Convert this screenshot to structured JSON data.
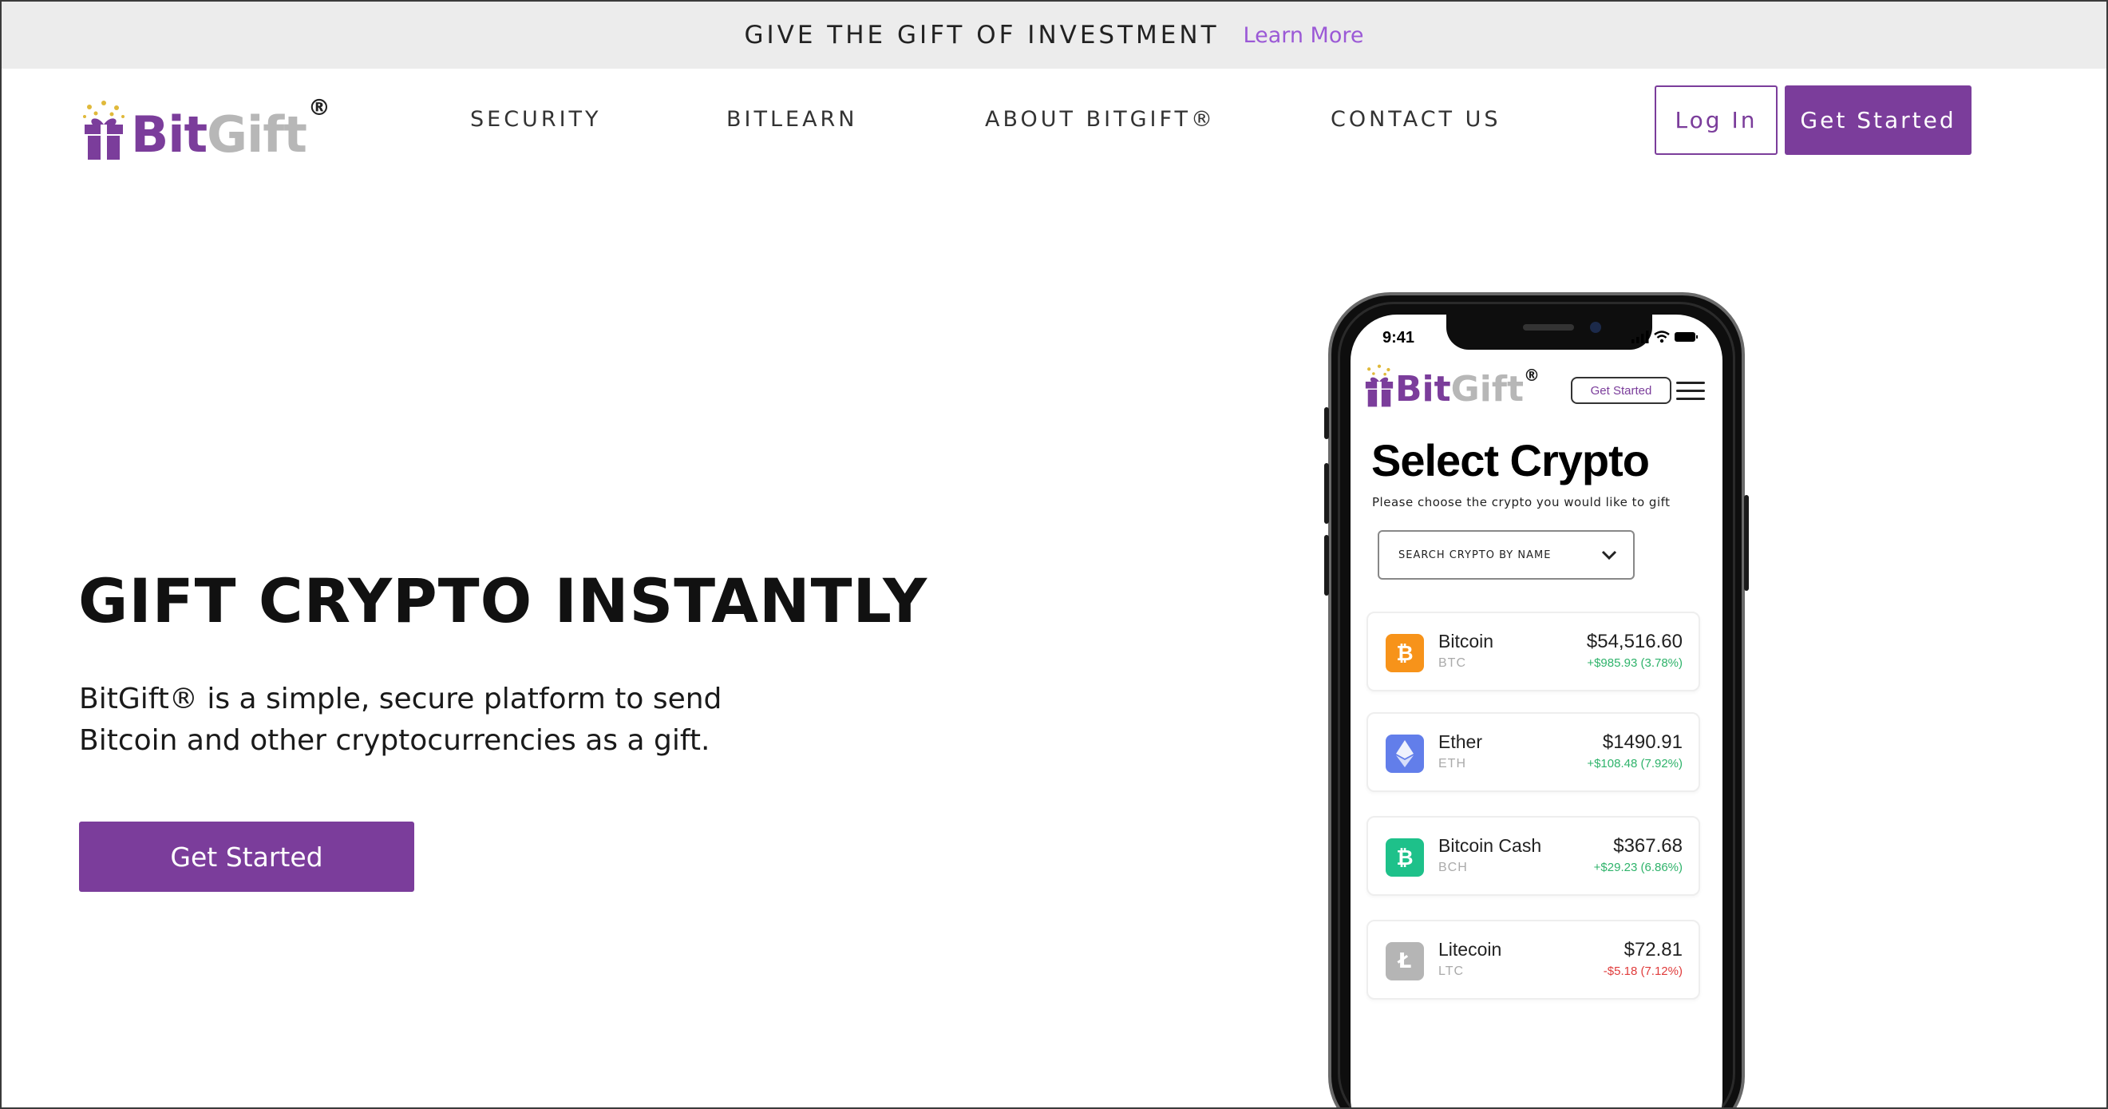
{
  "announcement": {
    "text": "GIVE THE GIFT OF INVESTMENT",
    "link": "Learn More"
  },
  "brand": {
    "bit": "Bit",
    "gift": "Gift",
    "reg": "®",
    "primary_color": "#7b3d9b",
    "secondary_color": "#b7b7b7"
  },
  "nav": {
    "items": [
      {
        "label": "SECURITY"
      },
      {
        "label": "BITLEARN"
      },
      {
        "label": "ABOUT BITGIFT®"
      },
      {
        "label": "CONTACT US"
      }
    ],
    "login_label": "Log In",
    "get_started_label": "Get Started"
  },
  "hero": {
    "title": "GIFT CRYPTO INSTANTLY",
    "subtitle": "BitGift® is a simple, secure platform to send Bitcoin and other cryptocurrencies as a gift.",
    "cta_label": "Get Started"
  },
  "phone": {
    "time": "9:41",
    "get_started_label": "Get Started",
    "title": "Select Crypto",
    "subtitle": "Please choose the crypto you would like to gift",
    "search_placeholder": "SEARCH CRYPTO BY NAME",
    "coins": [
      {
        "name": "Bitcoin",
        "symbol": "BTC",
        "price": "$54,516.60",
        "change": "+$985.93 (3.78%)",
        "direction": "up",
        "icon": "bitcoin-icon",
        "color": "#f7931a"
      },
      {
        "name": "Ether",
        "symbol": "ETH",
        "price": "$1490.91",
        "change": "+$108.48 (7.92%)",
        "direction": "up",
        "icon": "ether-icon",
        "color": "#627eea"
      },
      {
        "name": "Bitcoin Cash",
        "symbol": "BCH",
        "price": "$367.68",
        "change": "+$29.23 (6.86%)",
        "direction": "up",
        "icon": "bitcoin-cash-icon",
        "color": "#1ec18a"
      },
      {
        "name": "Litecoin",
        "symbol": "LTC",
        "price": "$72.81",
        "change": "-$5.18 (7.12%)",
        "direction": "down",
        "icon": "litecoin-icon",
        "color": "#b5b5b5"
      }
    ]
  }
}
